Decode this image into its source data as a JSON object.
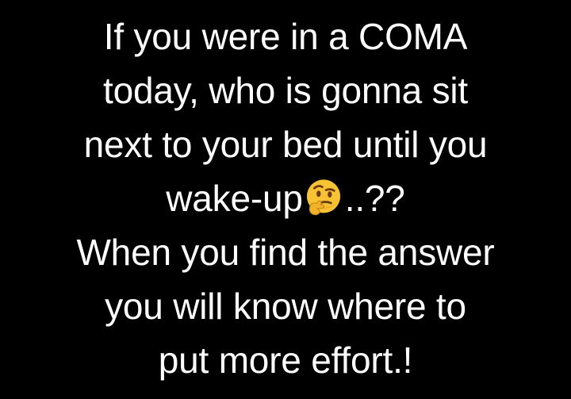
{
  "lines": [
    "If you were in a COMA",
    "today, who is gonna sit",
    "next to your bed until you",
    "..??",
    "When you find the answer",
    "you will know where to",
    "put more effort.!"
  ],
  "line4_prefix": "wake-up",
  "emoji": {
    "icon": "thinking-face-icon",
    "colors": {
      "face": "#F7C234",
      "face_shadow": "#E3A21E",
      "features": "#6B3A12",
      "hand": "#F2B12B"
    }
  },
  "colors": {
    "background": "#000000",
    "text": "#ffffff"
  }
}
